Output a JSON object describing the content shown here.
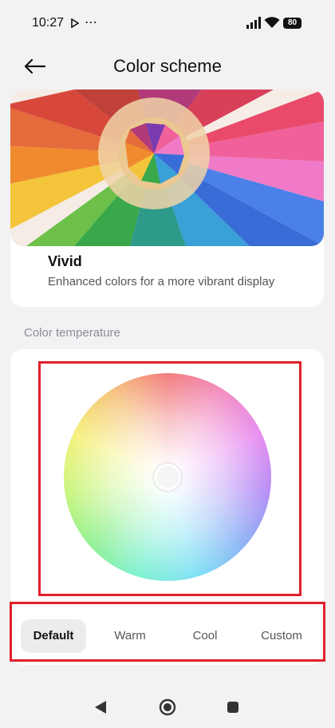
{
  "status_bar": {
    "time": "10:27",
    "battery": "80"
  },
  "header": {
    "title": "Color scheme"
  },
  "preview": {
    "mode_name": "Vivid",
    "mode_description": "Enhanced colors for a more vibrant display"
  },
  "temperature": {
    "section_label": "Color temperature",
    "tabs": [
      {
        "label": "Default",
        "selected": true
      },
      {
        "label": "Warm",
        "selected": false
      },
      {
        "label": "Cool",
        "selected": false
      },
      {
        "label": "Custom",
        "selected": false
      }
    ]
  },
  "colors": {
    "highlight_border": "#e0202a",
    "selected_tab_bg": "#ececee",
    "background": "#f2f2f4"
  }
}
